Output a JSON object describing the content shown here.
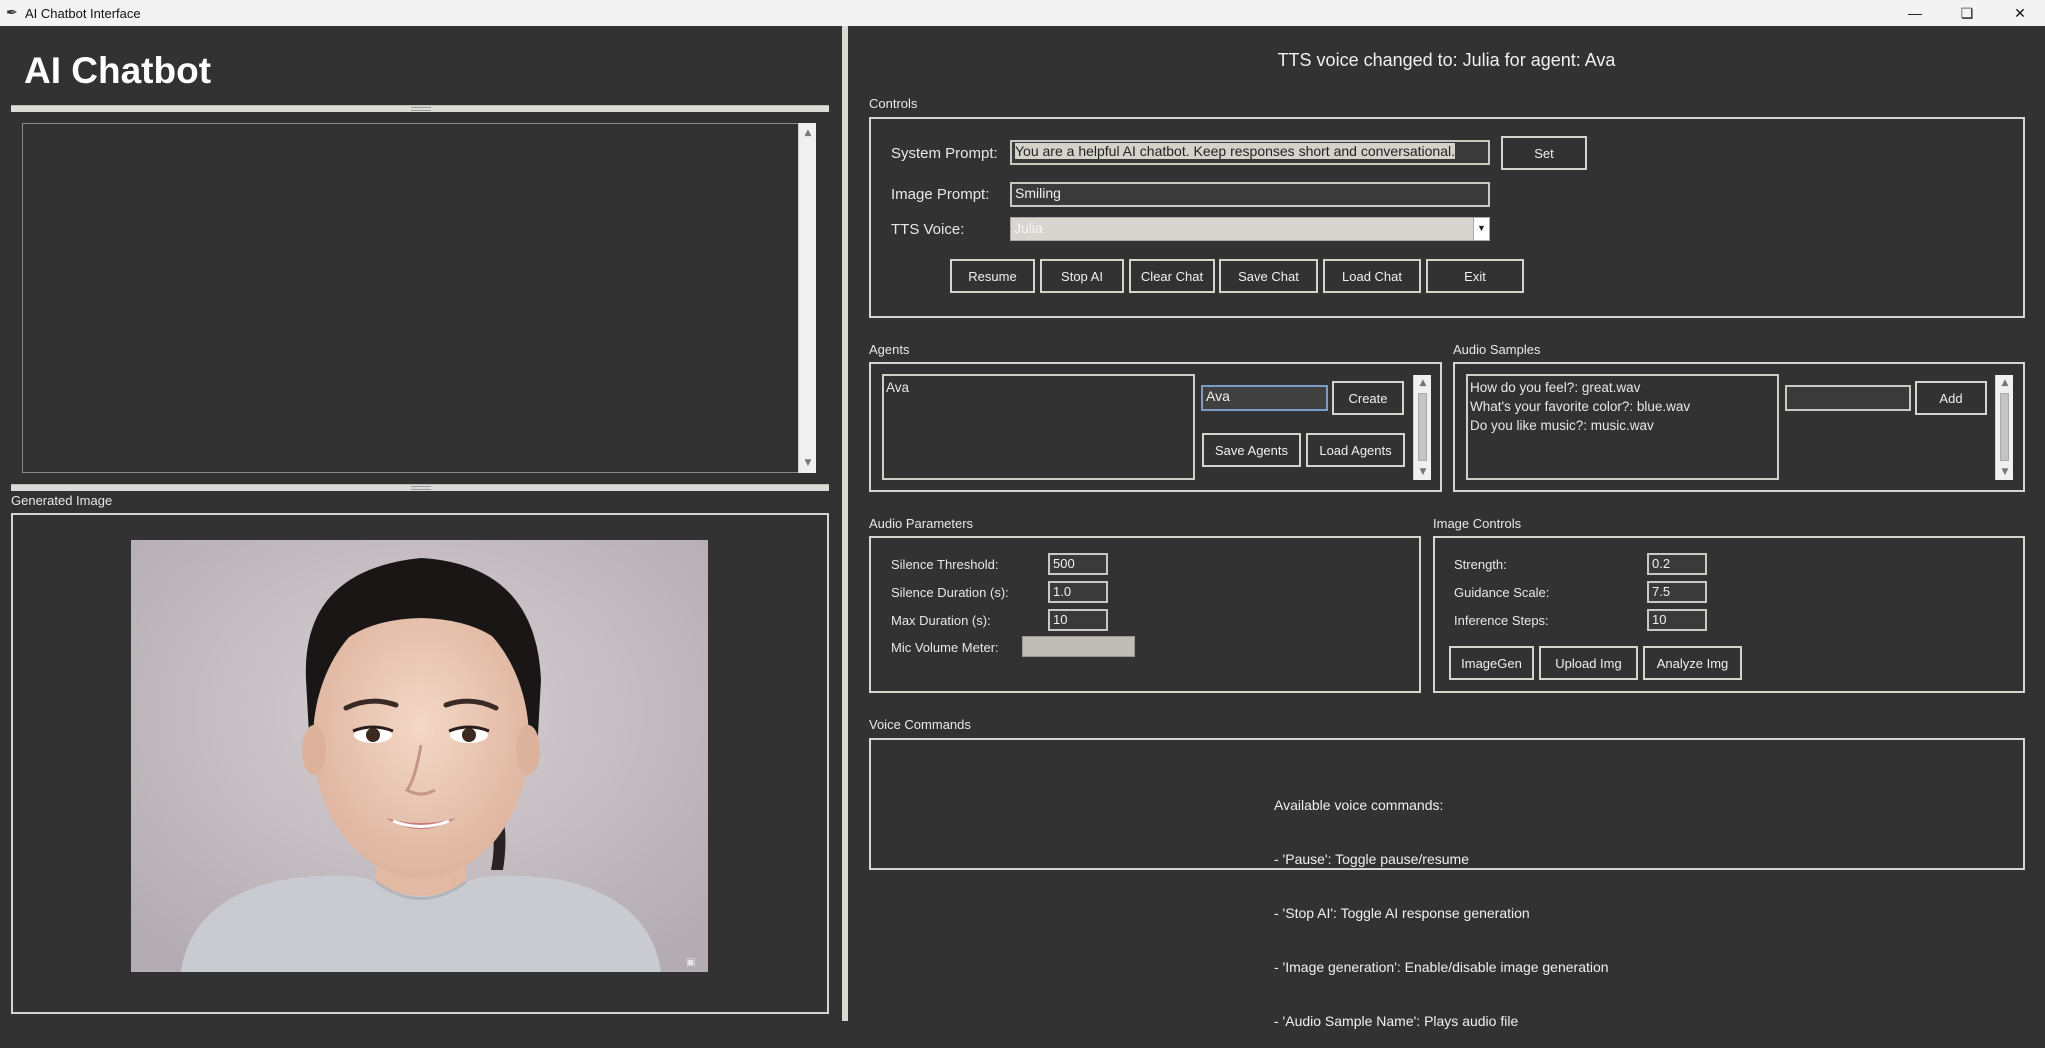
{
  "window": {
    "title": "AI Chatbot Interface",
    "minimize_icon": "minimize-icon",
    "maximize_icon": "restore-icon",
    "close_icon": "close-icon"
  },
  "left": {
    "heading": "AI Chatbot",
    "chat_text": "",
    "generated_image_label": "Generated Image"
  },
  "status": "TTS voice changed to: Julia for agent: Ava",
  "controls": {
    "label": "Controls",
    "system_prompt_label": "System Prompt:",
    "system_prompt_value": "You are a helpful AI chatbot. Keep responses short and conversational.",
    "set_label": "Set",
    "image_prompt_label": "Image Prompt:",
    "image_prompt_value": "Smiling",
    "tts_voice_label": "TTS Voice:",
    "tts_voice_value": "Julia",
    "buttons": [
      "Resume",
      "Stop AI",
      "Clear Chat",
      "Save Chat",
      "Load Chat",
      "Exit"
    ]
  },
  "agents": {
    "label": "Agents",
    "items": [
      "Ava"
    ],
    "entry_value": "Ava",
    "create_label": "Create",
    "save_label": "Save Agents",
    "load_label": "Load Agents"
  },
  "audio_samples": {
    "label": "Audio Samples",
    "items": [
      "How do you feel?: great.wav",
      "What's your favorite color?: blue.wav",
      "Do you like music?: music.wav"
    ],
    "entry_value": "",
    "add_label": "Add"
  },
  "audio_params": {
    "label": "Audio Parameters",
    "silence_threshold_label": "Silence Threshold:",
    "silence_threshold_value": "500",
    "silence_duration_label": "Silence Duration (s):",
    "silence_duration_value": "1.0",
    "max_duration_label": "Max Duration (s):",
    "max_duration_value": "10",
    "mic_meter_label": "Mic Volume Meter:",
    "mic_level": 0
  },
  "image_controls": {
    "label": "Image Controls",
    "strength_label": "Strength:",
    "strength_value": "0.2",
    "guidance_label": "Guidance Scale:",
    "guidance_value": "7.5",
    "steps_label": "Inference Steps:",
    "steps_value": "10",
    "imagegen_label": "ImageGen",
    "upload_label": "Upload Img",
    "analyze_label": "Analyze Img"
  },
  "voice_commands": {
    "label": "Voice Commands",
    "lines": [
      "Available voice commands:",
      "- 'Pause': Toggle pause/resume",
      "- 'Stop AI': Toggle AI response generation",
      "- 'Image generation': Enable/disable image generation",
      "- 'Audio Sample Name': Plays audio file"
    ]
  }
}
